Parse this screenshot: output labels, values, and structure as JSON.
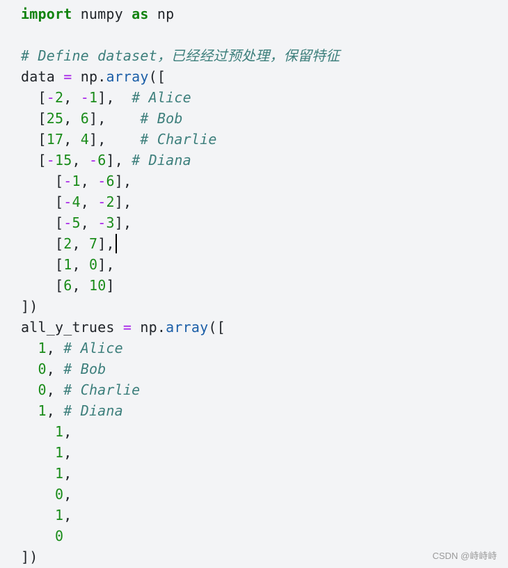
{
  "code": {
    "language": "python",
    "lines": [
      [
        {
          "t": "import",
          "c": "kw"
        },
        {
          "t": " numpy ",
          "c": "plain"
        },
        {
          "t": "as",
          "c": "kw"
        },
        {
          "t": " np",
          "c": "plain"
        }
      ],
      [],
      [
        {
          "t": "# Define dataset，已经经过预处理，保留特征",
          "c": "cm"
        }
      ],
      [
        {
          "t": "data ",
          "c": "plain"
        },
        {
          "t": "=",
          "c": "op"
        },
        {
          "t": " np.",
          "c": "plain"
        },
        {
          "t": "array",
          "c": "fn"
        },
        {
          "t": "([",
          "c": "plain"
        }
      ],
      [
        {
          "t": "  [",
          "c": "plain"
        },
        {
          "t": "-",
          "c": "op"
        },
        {
          "t": "2",
          "c": "num"
        },
        {
          "t": ", ",
          "c": "plain"
        },
        {
          "t": "-",
          "c": "op"
        },
        {
          "t": "1",
          "c": "num"
        },
        {
          "t": "],  ",
          "c": "plain"
        },
        {
          "t": "# Alice",
          "c": "cm"
        }
      ],
      [
        {
          "t": "  [",
          "c": "plain"
        },
        {
          "t": "25",
          "c": "num"
        },
        {
          "t": ", ",
          "c": "plain"
        },
        {
          "t": "6",
          "c": "num"
        },
        {
          "t": "],    ",
          "c": "plain"
        },
        {
          "t": "# Bob",
          "c": "cm"
        }
      ],
      [
        {
          "t": "  [",
          "c": "plain"
        },
        {
          "t": "17",
          "c": "num"
        },
        {
          "t": ", ",
          "c": "plain"
        },
        {
          "t": "4",
          "c": "num"
        },
        {
          "t": "],    ",
          "c": "plain"
        },
        {
          "t": "# Charlie",
          "c": "cm"
        }
      ],
      [
        {
          "t": "  [",
          "c": "plain"
        },
        {
          "t": "-",
          "c": "op"
        },
        {
          "t": "15",
          "c": "num"
        },
        {
          "t": ", ",
          "c": "plain"
        },
        {
          "t": "-",
          "c": "op"
        },
        {
          "t": "6",
          "c": "num"
        },
        {
          "t": "], ",
          "c": "plain"
        },
        {
          "t": "# Diana",
          "c": "cm"
        }
      ],
      [
        {
          "t": "    [",
          "c": "plain"
        },
        {
          "t": "-",
          "c": "op"
        },
        {
          "t": "1",
          "c": "num"
        },
        {
          "t": ", ",
          "c": "plain"
        },
        {
          "t": "-",
          "c": "op"
        },
        {
          "t": "6",
          "c": "num"
        },
        {
          "t": "],",
          "c": "plain"
        }
      ],
      [
        {
          "t": "    [",
          "c": "plain"
        },
        {
          "t": "-",
          "c": "op"
        },
        {
          "t": "4",
          "c": "num"
        },
        {
          "t": ", ",
          "c": "plain"
        },
        {
          "t": "-",
          "c": "op"
        },
        {
          "t": "2",
          "c": "num"
        },
        {
          "t": "],",
          "c": "plain"
        }
      ],
      [
        {
          "t": "    [",
          "c": "plain"
        },
        {
          "t": "-",
          "c": "op"
        },
        {
          "t": "5",
          "c": "num"
        },
        {
          "t": ", ",
          "c": "plain"
        },
        {
          "t": "-",
          "c": "op"
        },
        {
          "t": "3",
          "c": "num"
        },
        {
          "t": "],",
          "c": "plain"
        }
      ],
      [
        {
          "t": "    [",
          "c": "plain"
        },
        {
          "t": "2",
          "c": "num"
        },
        {
          "t": ", ",
          "c": "plain"
        },
        {
          "t": "7",
          "c": "num"
        },
        {
          "t": "],",
          "c": "plain"
        },
        {
          "t": "",
          "c": "cursor"
        }
      ],
      [
        {
          "t": "    [",
          "c": "plain"
        },
        {
          "t": "1",
          "c": "num"
        },
        {
          "t": ", ",
          "c": "plain"
        },
        {
          "t": "0",
          "c": "num"
        },
        {
          "t": "],",
          "c": "plain"
        }
      ],
      [
        {
          "t": "    [",
          "c": "plain"
        },
        {
          "t": "6",
          "c": "num"
        },
        {
          "t": ", ",
          "c": "plain"
        },
        {
          "t": "10",
          "c": "num"
        },
        {
          "t": "]",
          "c": "plain"
        }
      ],
      [
        {
          "t": "])",
          "c": "plain"
        }
      ],
      [
        {
          "t": "all_y_trues ",
          "c": "plain"
        },
        {
          "t": "=",
          "c": "op"
        },
        {
          "t": " np.",
          "c": "plain"
        },
        {
          "t": "array",
          "c": "fn"
        },
        {
          "t": "([",
          "c": "plain"
        }
      ],
      [
        {
          "t": "  ",
          "c": "plain"
        },
        {
          "t": "1",
          "c": "num"
        },
        {
          "t": ", ",
          "c": "plain"
        },
        {
          "t": "# Alice",
          "c": "cm"
        }
      ],
      [
        {
          "t": "  ",
          "c": "plain"
        },
        {
          "t": "0",
          "c": "num"
        },
        {
          "t": ", ",
          "c": "plain"
        },
        {
          "t": "# Bob",
          "c": "cm"
        }
      ],
      [
        {
          "t": "  ",
          "c": "plain"
        },
        {
          "t": "0",
          "c": "num"
        },
        {
          "t": ", ",
          "c": "plain"
        },
        {
          "t": "# Charlie",
          "c": "cm"
        }
      ],
      [
        {
          "t": "  ",
          "c": "plain"
        },
        {
          "t": "1",
          "c": "num"
        },
        {
          "t": ", ",
          "c": "plain"
        },
        {
          "t": "# Diana",
          "c": "cm"
        }
      ],
      [
        {
          "t": "    ",
          "c": "plain"
        },
        {
          "t": "1",
          "c": "num"
        },
        {
          "t": ",",
          "c": "plain"
        }
      ],
      [
        {
          "t": "    ",
          "c": "plain"
        },
        {
          "t": "1",
          "c": "num"
        },
        {
          "t": ",",
          "c": "plain"
        }
      ],
      [
        {
          "t": "    ",
          "c": "plain"
        },
        {
          "t": "1",
          "c": "num"
        },
        {
          "t": ",",
          "c": "plain"
        }
      ],
      [
        {
          "t": "    ",
          "c": "plain"
        },
        {
          "t": "0",
          "c": "num"
        },
        {
          "t": ",",
          "c": "plain"
        }
      ],
      [
        {
          "t": "    ",
          "c": "plain"
        },
        {
          "t": "1",
          "c": "num"
        },
        {
          "t": ",",
          "c": "plain"
        }
      ],
      [
        {
          "t": "    ",
          "c": "plain"
        },
        {
          "t": "0",
          "c": "num"
        }
      ],
      [
        {
          "t": "])",
          "c": "plain"
        }
      ]
    ]
  },
  "colors": {
    "background": "#f3f4f6",
    "keyword": "#12830f",
    "operator": "#a51ee8",
    "number": "#1a8c1a",
    "function": "#1c5fa8",
    "comment": "#3d7f7c",
    "text": "#1f2328"
  },
  "watermark": "CSDN @峙峙峙"
}
